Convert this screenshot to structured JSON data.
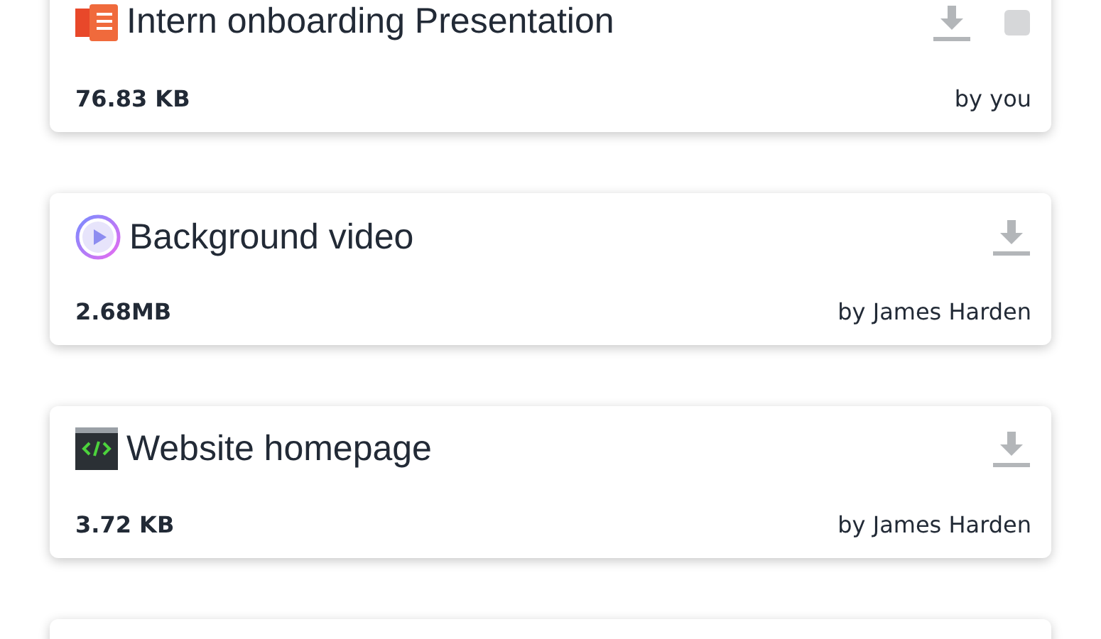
{
  "files": [
    {
      "kind": "presentation",
      "name": "Intern onboarding Presentation",
      "size": "76.83 KB",
      "owner": "by you",
      "extra_action": true
    },
    {
      "kind": "video",
      "name": "Background video",
      "size": "2.68MB",
      "owner": "by James Harden",
      "extra_action": false
    },
    {
      "kind": "code",
      "name": "Website homepage",
      "size": "3.72 KB",
      "owner": "by James Harden",
      "extra_action": false
    },
    {
      "kind": "empty"
    }
  ]
}
